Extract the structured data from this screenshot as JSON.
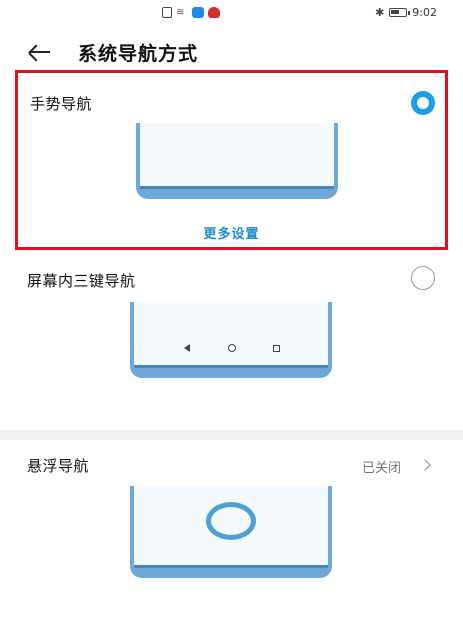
{
  "status_bar": {
    "time": "9:02",
    "icons": [
      "notification-icon",
      "wifi-icon",
      "app-blue-icon",
      "app-huawei-icon",
      "bluetooth-icon",
      "battery-icon"
    ],
    "battery_level": 0.65
  },
  "header": {
    "back_icon": "arrow-left-icon",
    "title": "系统导航方式"
  },
  "options": [
    {
      "label": "手势导航",
      "selected": true,
      "more_settings": "更多设置"
    },
    {
      "label": "屏幕内三键导航",
      "selected": false,
      "nav_keys": [
        "back-triangle-icon",
        "home-circle-icon",
        "recent-square-icon"
      ]
    },
    {
      "label": "悬浮导航",
      "status": "已关闭"
    }
  ],
  "colors": {
    "accent": "#1a9ee8",
    "highlight": "#e0121b",
    "phone_frame": "#6fa8d6",
    "link": "#1f8dc9"
  }
}
